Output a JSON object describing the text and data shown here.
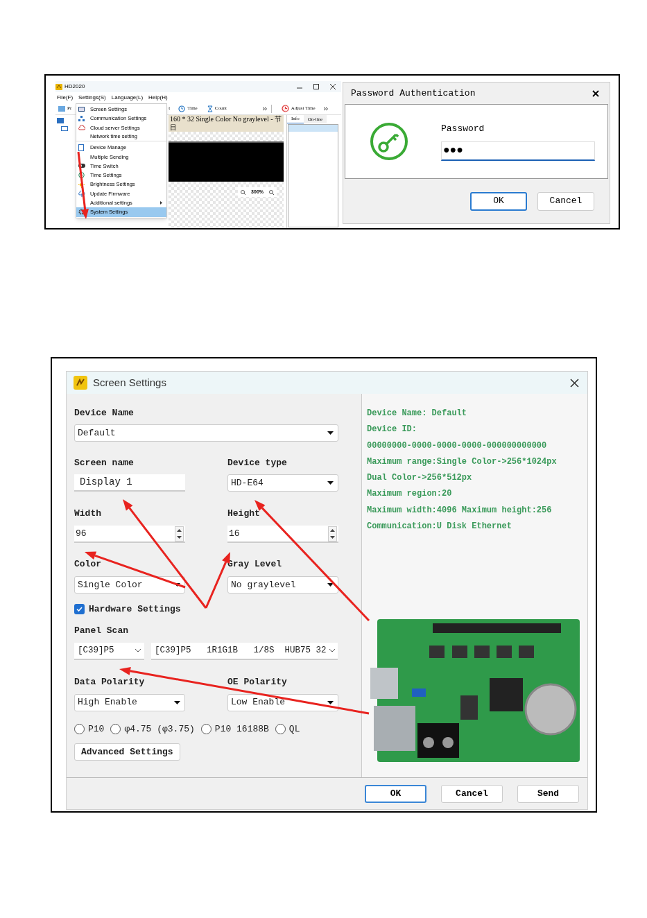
{
  "app_window": {
    "title": "HD2020",
    "menu_bar": [
      "File(F)",
      "Settings(S)",
      "Language(L)",
      "Help(H)"
    ],
    "toolbar": [
      {
        "label": "Pr"
      },
      {
        "label": "t"
      },
      {
        "label": "Time"
      },
      {
        "label": "Count"
      },
      {
        "label": "Adjust Time"
      }
    ],
    "status_line": "160 * 32 Single Color No graylevel - 节目",
    "zoom": "300%",
    "side_tabs": [
      {
        "label": "Info",
        "selected": true
      },
      {
        "label": "On-line",
        "selected": false
      }
    ],
    "settings_menu": [
      {
        "label": "Screen Settings",
        "selected": false,
        "separator_after": false,
        "submenu": false
      },
      {
        "label": "Communication Settings",
        "selected": false,
        "separator_after": false,
        "submenu": false
      },
      {
        "label": "Cloud server Settings",
        "selected": false,
        "separator_after": false,
        "submenu": false
      },
      {
        "label": "Network time setting",
        "selected": false,
        "separator_after": true,
        "submenu": false
      },
      {
        "label": "Device Manage",
        "selected": false,
        "separator_after": false,
        "submenu": false
      },
      {
        "label": "Multiple Sending",
        "selected": false,
        "separator_after": false,
        "submenu": false
      },
      {
        "label": "Time Switch",
        "selected": false,
        "separator_after": false,
        "submenu": false
      },
      {
        "label": "Time Settings",
        "selected": false,
        "separator_after": false,
        "submenu": false
      },
      {
        "label": "Brightness Settings",
        "selected": false,
        "separator_after": false,
        "submenu": false
      },
      {
        "label": "Update Firmware",
        "selected": false,
        "separator_after": false,
        "submenu": false
      },
      {
        "label": "Additional settings",
        "selected": false,
        "separator_after": false,
        "submenu": true
      },
      {
        "label": "System Settings",
        "selected": true,
        "separator_after": false,
        "submenu": false
      }
    ]
  },
  "password_dialog": {
    "title": "Password Authentication",
    "label": "Password",
    "value": "●●●",
    "buttons": [
      {
        "label": "OK",
        "default": true
      },
      {
        "label": "Cancel",
        "default": false
      }
    ]
  },
  "screen_settings": {
    "title": "Screen Settings",
    "device_name": {
      "label": "Device Name",
      "value": "Default"
    },
    "screen_name": {
      "label": "Screen name",
      "value": "Display 1"
    },
    "device_type": {
      "label": "Device type",
      "value": "HD-E64"
    },
    "width": {
      "label": "Width",
      "value": "96"
    },
    "height": {
      "label": "Height",
      "value": "16"
    },
    "color": {
      "label": "Color",
      "value": "Single Color"
    },
    "gray_level": {
      "label": "Gray Level",
      "value": "No graylevel"
    },
    "hardware_settings": {
      "label": "Hardware Settings",
      "checked": true
    },
    "panel_scan": {
      "label": "Panel Scan",
      "values": [
        "[C39]P5",
        "[C39]P5   1R1G1B   1/8S  HUB75 32"
      ]
    },
    "data_polarity": {
      "label": "Data Polarity",
      "value": "High Enable"
    },
    "oe_polarity": {
      "label": "OE Polarity",
      "value": "Low Enable"
    },
    "panel_types": [
      {
        "label": "P10",
        "selected": false
      },
      {
        "label": "φ4.75 (φ3.75)",
        "selected": false
      },
      {
        "label": "P10 16188B",
        "selected": false
      },
      {
        "label": "QL",
        "selected": false
      }
    ],
    "advanced_button": "Advanced Settings",
    "info_lines": [
      "Device Name: Default",
      "Device ID:",
      "00000000-0000-0000-0000-000000000000",
      "Maximum range:Single Color->256*1024px",
      "Dual Color->256*512px",
      "Maximum region:20",
      "Maximum width:4096 Maximum height:256",
      "Communication:U Disk  Ethernet"
    ],
    "buttons": [
      {
        "label": "OK",
        "default": true
      },
      {
        "label": "Cancel",
        "default": false
      },
      {
        "label": "Send",
        "default": false
      }
    ]
  }
}
